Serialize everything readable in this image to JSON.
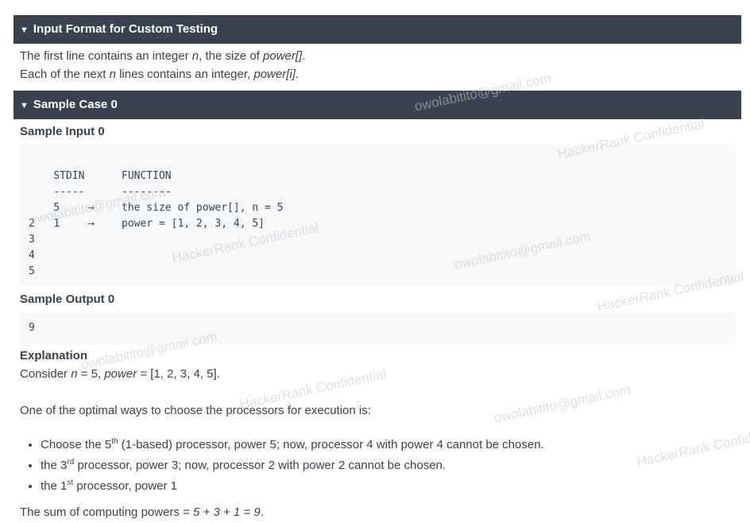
{
  "input_format": {
    "header": "Input Format for Custom Testing",
    "line1": {
      "pre": "The first line contains an integer ",
      "var": "n",
      "mid": ", the size of ",
      "arr": "power[]",
      "post": "."
    },
    "line2": {
      "pre": "Each of the next ",
      "var": "n",
      "mid": " lines contains an integer, ",
      "arr": "power[i]",
      "post": "."
    }
  },
  "sample_case": {
    "header": "Sample Case 0",
    "input_title": "Sample Input 0",
    "stdin_header": "STDIN",
    "stdin_rule": "-----",
    "function_header": "FUNCTION",
    "function_rule": "--------",
    "rows": [
      {
        "stdin": "5",
        "arrow": "→",
        "fn": "the size of power[], n = 5"
      },
      {
        "stdin": "1",
        "arrow": "→",
        "fn": "power = [1, 2, 3, 4, 5]"
      },
      {
        "stdin": "2",
        "arrow": "",
        "fn": ""
      },
      {
        "stdin": "3",
        "arrow": "",
        "fn": ""
      },
      {
        "stdin": "4",
        "arrow": "",
        "fn": ""
      },
      {
        "stdin": "5",
        "arrow": "",
        "fn": ""
      }
    ],
    "output_title": "Sample Output 0",
    "output_value": "9",
    "explanation_title": "Explanation",
    "consider": {
      "pre": "Consider ",
      "n": "n",
      "n_val": " = 5, ",
      "power": "power",
      "power_val": " = [1, 2, 3, 4, 5]."
    },
    "optimal_line": "One of the optimal ways to choose the processors for execution is:",
    "bullets": [
      {
        "pre": "Choose the 5",
        "sup": "th",
        "post": " (1-based) processor, power 5; now, processor 4 with power 4 cannot be chosen."
      },
      {
        "pre": "the 3",
        "sup": "rd",
        "post": " processor, power 3; now, processor 2 with power 2 cannot be chosen."
      },
      {
        "pre": "the 1",
        "sup": "st",
        "post": " processor, power 1"
      }
    ],
    "sum_line": {
      "pre": "The sum of computing powers = ",
      "expr": "5 + 3 + 1 = 9",
      "post": "."
    }
  },
  "watermarks": {
    "email": "owolabitito@gmail.com",
    "confidential": "HackerRank Confidential"
  },
  "colors": {
    "header_bg": "#39424e",
    "header_text": "#ffffff",
    "code_bg": "#f7f8f9",
    "text": "#39424e"
  }
}
